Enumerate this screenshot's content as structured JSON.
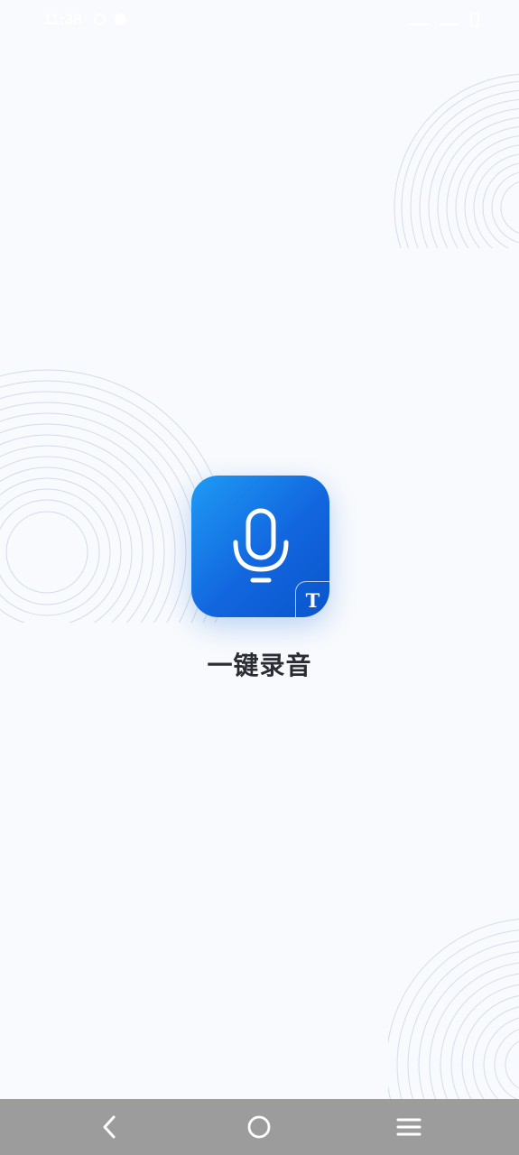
{
  "status_bar": {
    "time": "11:38"
  },
  "app": {
    "name": "一键录音",
    "icon": "microphone-icon",
    "badge_letter": "T",
    "accent_color": "#1570e3"
  },
  "nav_bar": {
    "back_icon": "back-chevron-icon",
    "home_icon": "home-circle-icon",
    "menu_icon": "menu-lines-icon"
  }
}
